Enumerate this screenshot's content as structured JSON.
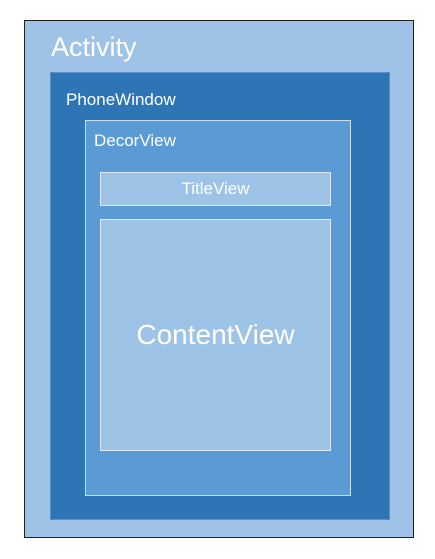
{
  "diagram": {
    "activity": {
      "label": "Activity"
    },
    "phone_window": {
      "label": "PhoneWindow"
    },
    "decor_view": {
      "label": "DecorView"
    },
    "title_view": {
      "label": "TitleView"
    },
    "content_view": {
      "label": "ContentView"
    }
  },
  "colors": {
    "activity_fill": "#9fc3e7",
    "phone_window_fill": "#2e75b6",
    "decor_view_fill": "#5b9bd5",
    "inner_view_fill": "#9dc3e6",
    "text": "#ffffff"
  }
}
